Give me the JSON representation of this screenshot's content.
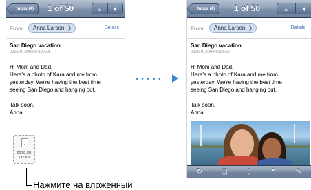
{
  "phone1": {
    "back_label": "Inbox (4)",
    "counter": "1 of 50",
    "nav_up": "▲",
    "nav_down": "▼",
    "from_label": "From:",
    "from_name": "Anna Larson",
    "details": "Details",
    "subject": "San Diego vacation",
    "date": "June 9, 2009 9:39 AM",
    "body": [
      "Hi Mom and Dad,",
      "Here's a photo of Kara and me from",
      "yesterday. We're having the best time",
      "seeing San Diego and hanging out."
    ],
    "signoff": [
      "Talk soon,",
      "Anna"
    ],
    "attachment": {
      "name": "photo.jpg",
      "size": "142 KB",
      "icon": "download-icon"
    }
  },
  "phone2": {
    "back_label": "Inbox (4)",
    "counter": "1 of 50",
    "nav_up": "▲",
    "nav_down": "▼",
    "from_label": "From:",
    "from_name": "Anna Larson",
    "details": "Details",
    "subject": "San Diego vacation",
    "date": "June 9, 2009 9:39 AM",
    "body": [
      "Hi Mom and Dad,",
      "Here's a photo of Kara and me from",
      "yesterday. We're having the best time",
      "seeing San Diego and hanging out."
    ],
    "signoff": [
      "Talk soon,",
      "Anna"
    ],
    "toolbar_icons": [
      "refresh-icon",
      "folder-icon",
      "trash-icon",
      "reply-icon",
      "compose-icon"
    ]
  },
  "arrow": {
    "dots": "• • • • •",
    "color": "#3a84c8"
  },
  "caption": "Нажмите на вложенный"
}
